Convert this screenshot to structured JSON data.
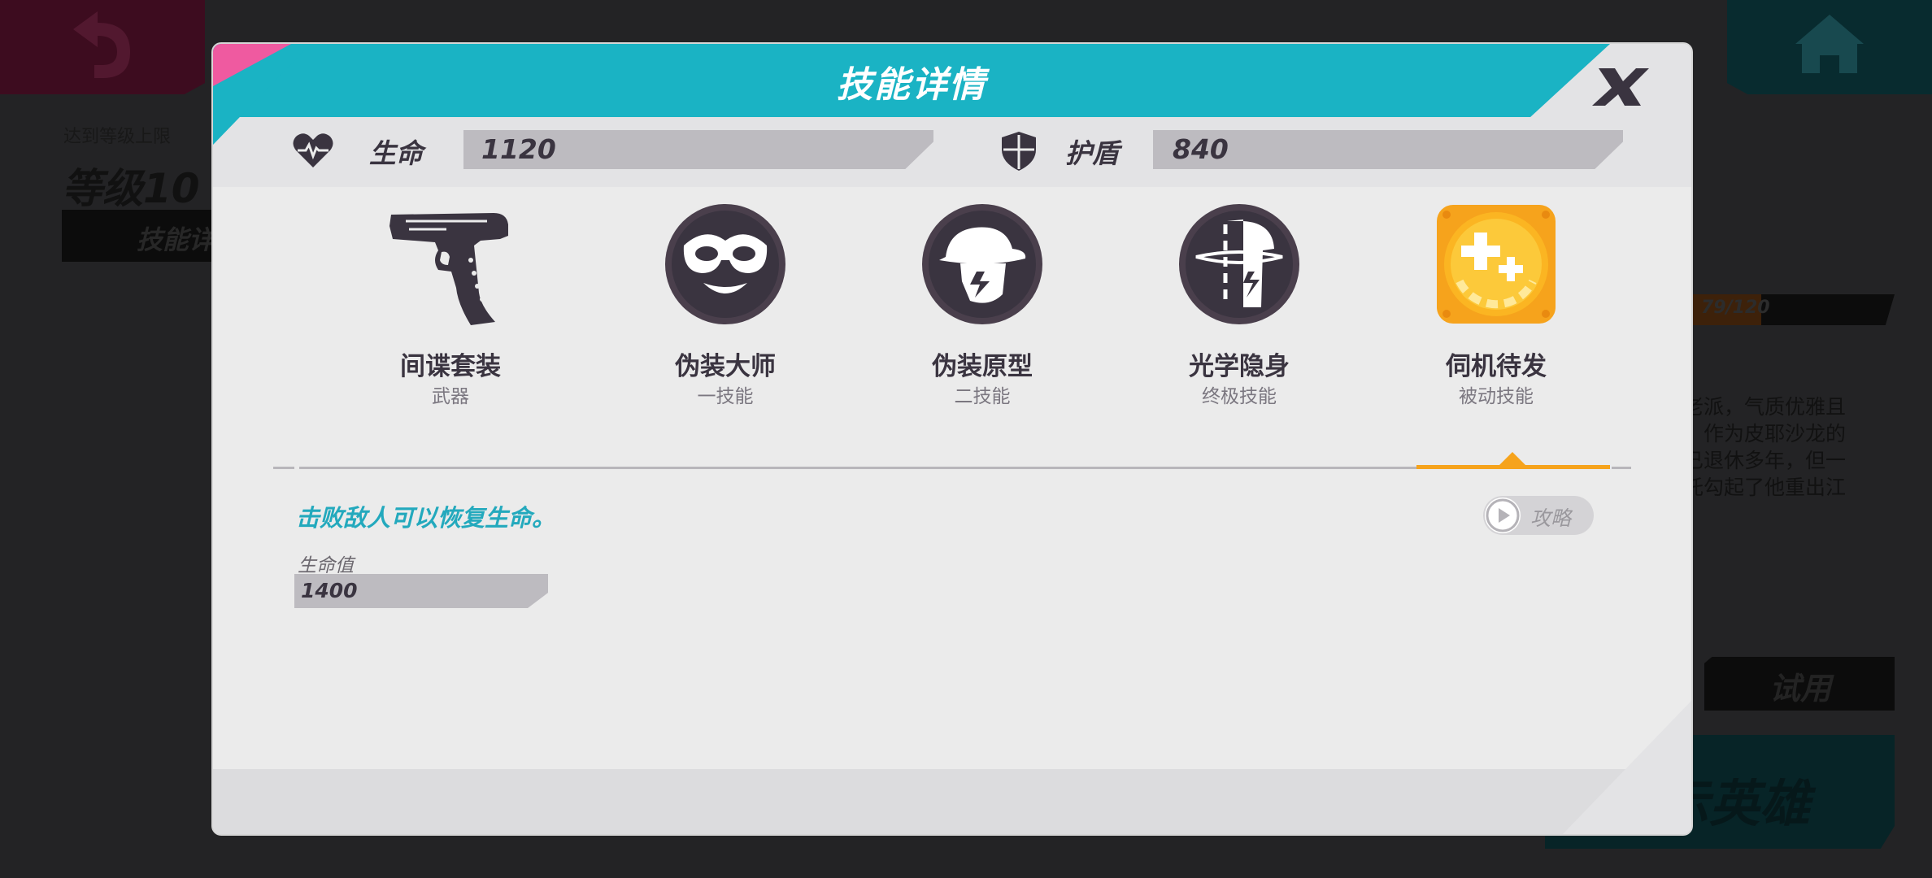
{
  "background": {
    "reach_text": "达到等级上限",
    "level_text": "等级10",
    "skill_btn_text": "技能详",
    "progress_text": "79/120",
    "desc_lines": [
      "老派，气质优雅且",
      "。作为皮耶沙龙的",
      "已退休多年，但一",
      "托勾起了他重出江"
    ],
    "try_label": "试用",
    "show_label": "示英雄"
  },
  "modal": {
    "title": "技能详情",
    "close_label": "X",
    "stats": {
      "hp_label": "生命",
      "hp_value": "1120",
      "shield_label": "护盾",
      "shield_value": "840"
    },
    "skills": [
      {
        "name": "间谍套装",
        "type": "武器",
        "icon": "pistol-icon"
      },
      {
        "name": "伪装大师",
        "type": "一技能",
        "icon": "mask-icon"
      },
      {
        "name": "伪装原型",
        "type": "二技能",
        "icon": "hat-disguise-icon"
      },
      {
        "name": "光学隐身",
        "type": "终极技能",
        "icon": "invisibility-icon"
      },
      {
        "name": "伺机待发",
        "type": "被动技能",
        "icon": "heal-passive-icon"
      }
    ],
    "selected_skill_index": 4,
    "detail": {
      "description": "击败敌人可以恢复生命。",
      "guide_label": "攻略",
      "stat_label": "生命值",
      "stat_value": "1400"
    }
  },
  "colors": {
    "title_bar": "#1ab3c4",
    "accent_pink": "#ef5aa0",
    "active_tab": "#f6a31c",
    "description_text": "#23a9bd",
    "icon_dark": "#3a3440"
  }
}
